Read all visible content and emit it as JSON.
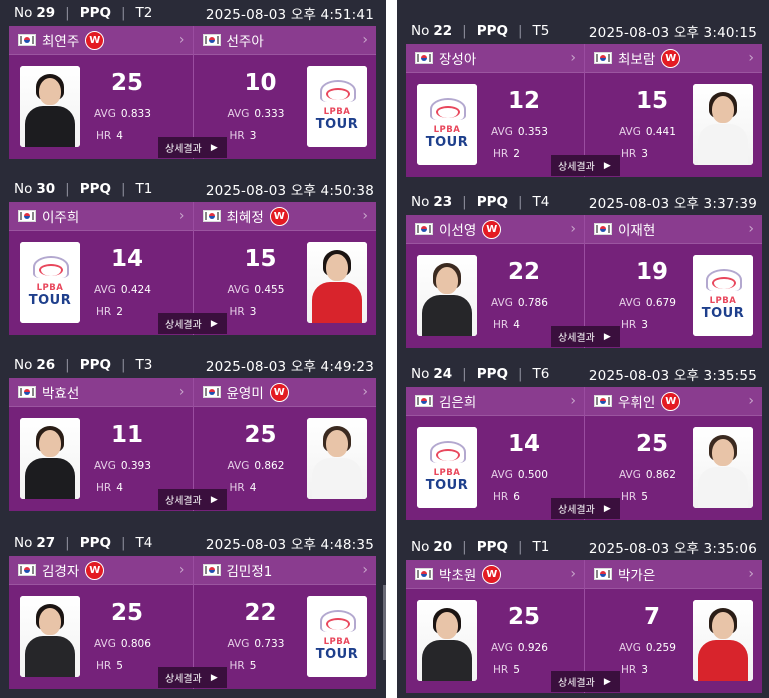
{
  "labels": {
    "no": "No",
    "avg": "AVG",
    "hr": "HR",
    "detail": "상세결과",
    "w_badge": "W",
    "logo_line1": "LPBA",
    "logo_line2": "TOUR"
  },
  "colors": {
    "background": "#2a2b38",
    "card": "#75227a",
    "name_bar": "#8a3c8f",
    "win_badge": "#e31b23",
    "detail_button": "#3a0f3d"
  },
  "icons": {
    "flag": "korea-flag-icon",
    "chevron": "chevron-right-icon",
    "play": "play-triangle-icon",
    "logo": "lpba-tour-logo"
  },
  "left_matches": [
    {
      "no": "29",
      "type": "PPQ",
      "table": "T2",
      "time": "2025-08-03 오후 4:51:41",
      "p1": {
        "name": "최연주",
        "winner": true,
        "score": "25",
        "avg": "0.833",
        "hr": "4",
        "photo": "person"
      },
      "p2": {
        "name": "선주아",
        "winner": false,
        "score": "10",
        "avg": "0.333",
        "hr": "3",
        "photo": "logo"
      }
    },
    {
      "no": "30",
      "type": "PPQ",
      "table": "T1",
      "time": "2025-08-03 오후 4:50:38",
      "p1": {
        "name": "이주희",
        "winner": false,
        "score": "14",
        "avg": "0.424",
        "hr": "2",
        "photo": "logo"
      },
      "p2": {
        "name": "최혜정",
        "winner": true,
        "score": "15",
        "avg": "0.455",
        "hr": "3",
        "photo": "person"
      }
    },
    {
      "no": "26",
      "type": "PPQ",
      "table": "T3",
      "time": "2025-08-03 오후 4:49:23",
      "p1": {
        "name": "박효선",
        "winner": false,
        "score": "11",
        "avg": "0.393",
        "hr": "4",
        "photo": "person"
      },
      "p2": {
        "name": "윤영미",
        "winner": true,
        "score": "25",
        "avg": "0.862",
        "hr": "4",
        "photo": "person"
      }
    },
    {
      "no": "27",
      "type": "PPQ",
      "table": "T4",
      "time": "2025-08-03 오후 4:48:35",
      "p1": {
        "name": "김경자",
        "winner": true,
        "score": "25",
        "avg": "0.806",
        "hr": "5",
        "photo": "person"
      },
      "p2": {
        "name": "김민정1",
        "winner": false,
        "score": "22",
        "avg": "0.733",
        "hr": "5",
        "photo": "logo"
      }
    }
  ],
  "right_matches": [
    {
      "no": "22",
      "type": "PPQ",
      "table": "T5",
      "time": "2025-08-03 오후 3:40:15",
      "p1": {
        "name": "장성아",
        "winner": false,
        "score": "12",
        "avg": "0.353",
        "hr": "2",
        "photo": "logo"
      },
      "p2": {
        "name": "최보람",
        "winner": true,
        "score": "15",
        "avg": "0.441",
        "hr": "3",
        "photo": "person"
      }
    },
    {
      "no": "23",
      "type": "PPQ",
      "table": "T4",
      "time": "2025-08-03 오후 3:37:39",
      "p1": {
        "name": "이선영",
        "winner": true,
        "score": "22",
        "avg": "0.786",
        "hr": "4",
        "photo": "person"
      },
      "p2": {
        "name": "이재현",
        "winner": false,
        "score": "19",
        "avg": "0.679",
        "hr": "3",
        "photo": "logo"
      }
    },
    {
      "no": "24",
      "type": "PPQ",
      "table": "T6",
      "time": "2025-08-03 오후 3:35:55",
      "p1": {
        "name": "김은희",
        "winner": false,
        "score": "14",
        "avg": "0.500",
        "hr": "6",
        "photo": "logo"
      },
      "p2": {
        "name": "우휘인",
        "winner": true,
        "score": "25",
        "avg": "0.862",
        "hr": "5",
        "photo": "person"
      }
    },
    {
      "no": "20",
      "type": "PPQ",
      "table": "T1",
      "time": "2025-08-03 오후 3:35:06",
      "p1": {
        "name": "박초원",
        "winner": true,
        "score": "25",
        "avg": "0.926",
        "hr": "5",
        "photo": "person"
      },
      "p2": {
        "name": "박가은",
        "winner": false,
        "score": "7",
        "avg": "0.259",
        "hr": "3",
        "photo": "person"
      }
    }
  ]
}
